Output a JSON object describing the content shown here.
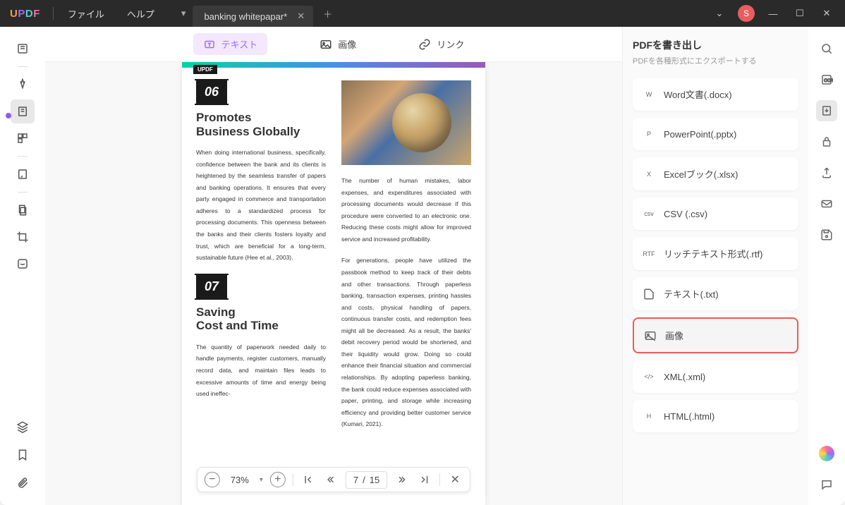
{
  "titlebar": {
    "menu_file": "ファイル",
    "menu_help": "ヘルプ",
    "tab_title": "banking whitepapar*",
    "avatar_letter": "S"
  },
  "toolbar": {
    "text": "テキスト",
    "image": "画像",
    "link": "リンク"
  },
  "document": {
    "brand": "UPDF",
    "section06_num": "06",
    "section06_title": "Promotes\nBusiness Globally",
    "section06_p1": "When doing international business, specifically, confidence between the bank and its clients is heightened by the seamless transfer of papers and banking operations. It ensures that every party engaged in commerce and transportation adheres to a standardized process for processing documents. This openness between the banks and their clients fosters loyalty and trust, which are beneficial for a long-term, sustainable future (Hee et al., 2003).",
    "section06_p2": "The number of human mistakes, labor expenses, and expenditures associated with processing documents would decrease if this procedure were converted to an electronic one. Reducing these costs might allow for improved service and increased profitability.",
    "section07_num": "07",
    "section07_title": "Saving\nCost and Time",
    "section07_p1": "The quantity of paperwork needed daily to handle payments, register customers, manually record data, and maintain files leads to excessive amounts of time and energy being used ineffec-",
    "section07_p2": "For generations, people have utilized the passbook method to keep track of their debts and other transactions. Through paperless banking, transaction expenses, printing hassles and costs, physical handling of papers, continuous transfer costs, and redemption fees might all be decreased. As a result, the banks' debit recovery period would be shortened, and their liquidity would grow. Doing so could enhance their financial situation and commercial relationships. By adopting paperless banking, the bank could reduce expenses associated with paper, printing, and storage while increasing efficiency and providing better customer service (Kumari, 2021)."
  },
  "bottombar": {
    "zoom": "73%",
    "page_current": "7",
    "page_sep": "/",
    "page_total": "15"
  },
  "export_panel": {
    "title": "PDFを書き出し",
    "subtitle": "PDFを各種形式にエクスポートする",
    "formats": {
      "word": "Word文書(.docx)",
      "ppt": "PowerPoint(.pptx)",
      "xls": "Excelブック(.xlsx)",
      "csv": "CSV (.csv)",
      "rtf": "リッチテキスト形式(.rtf)",
      "txt": "テキスト(.txt)",
      "img": "画像",
      "xml": "XML(.xml)",
      "html": "HTML(.html)"
    }
  }
}
